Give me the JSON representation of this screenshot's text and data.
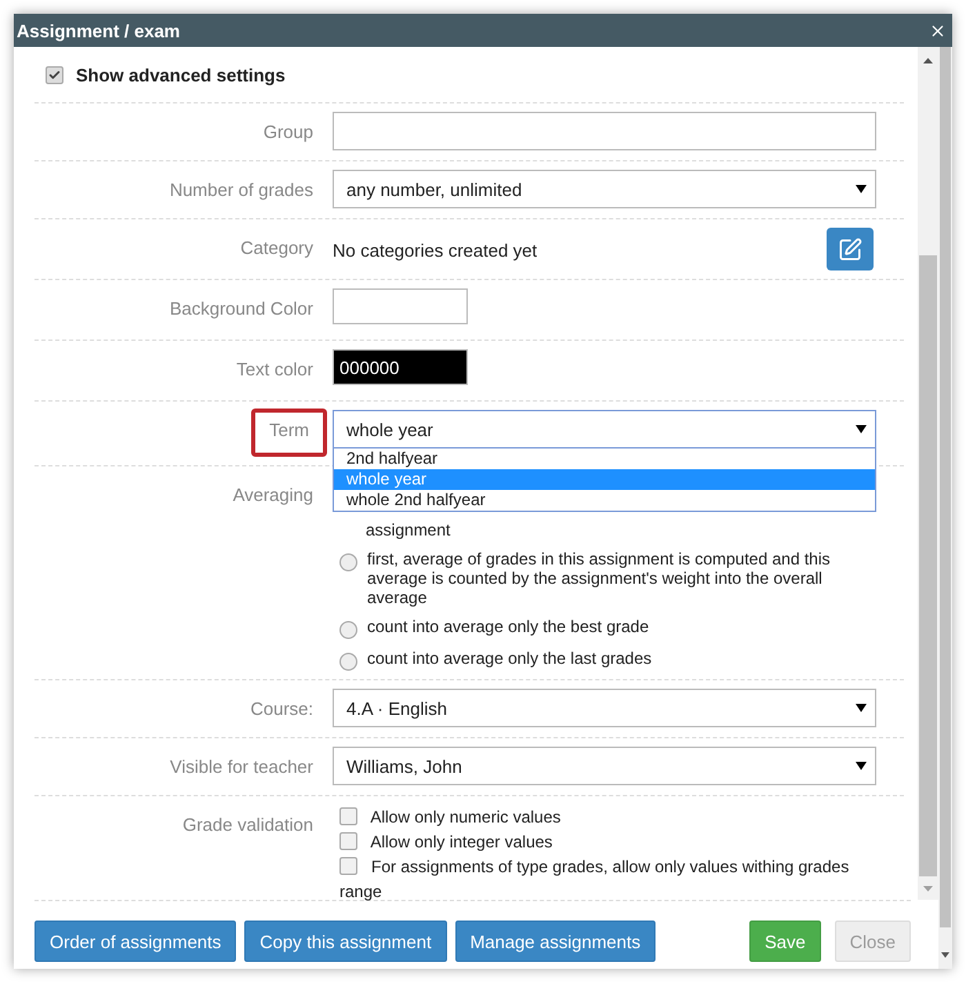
{
  "dialog": {
    "title": "Assignment / exam"
  },
  "advanced": {
    "label": "Show advanced settings",
    "checked": true
  },
  "fields": [
    {
      "kind": "input",
      "label": "Group"
    },
    {
      "kind": "select",
      "label": "Number of grades",
      "value": "any number, unlimited"
    },
    {
      "kind": "category",
      "label": "Category",
      "value": "No categories created yet"
    },
    {
      "kind": "color",
      "label": "Background Color",
      "color": "#ffffff"
    },
    {
      "kind": "color",
      "label": "Text color",
      "value": "000000",
      "color": "#000000"
    },
    {
      "kind": "select",
      "label": "Term",
      "value": "whole year",
      "highlighted": true,
      "open": true,
      "options": [
        {
          "label": "2nd halfyear",
          "selected": false
        },
        {
          "label": "whole year",
          "selected": true
        },
        {
          "label": "whole 2nd halfyear",
          "selected": false
        }
      ]
    },
    {
      "kind": "radios",
      "label": "Averaging",
      "options": [
        {
          "label": "assignment",
          "kind": "covered"
        },
        {
          "label": "first, average of grades in this assignment is computed and this average is counted by the assignment's weight into the overall average",
          "kind": "radio",
          "selected": false
        },
        {
          "label": "count into average only the best grade",
          "kind": "radio",
          "selected": false
        },
        {
          "label": "count into average only the last grades",
          "kind": "radio",
          "selected": false
        }
      ]
    },
    {
      "kind": "select",
      "label": "Course:",
      "value": "4.A · English"
    },
    {
      "kind": "select",
      "label": "Visible for teacher",
      "value": "Williams, John"
    },
    {
      "kind": "checks",
      "label": "Grade validation",
      "options": [
        {
          "label": "Allow only numeric values",
          "checked": false
        },
        {
          "label": "Allow only integer values",
          "checked": false
        },
        {
          "label": "For assignments of type grades, allow only values withing grades range",
          "checked": false
        }
      ]
    }
  ],
  "buttons": [
    {
      "label": "Order of assignments",
      "kind": "primary",
      "disabled": false
    },
    {
      "label": "Copy this assignment",
      "kind": "primary",
      "disabled": false
    },
    {
      "label": "Manage assignments",
      "kind": "primary",
      "disabled": false
    },
    {
      "label": "Save",
      "kind": "success",
      "disabled": false
    },
    {
      "label": "Close",
      "kind": "default",
      "disabled": true
    }
  ]
}
